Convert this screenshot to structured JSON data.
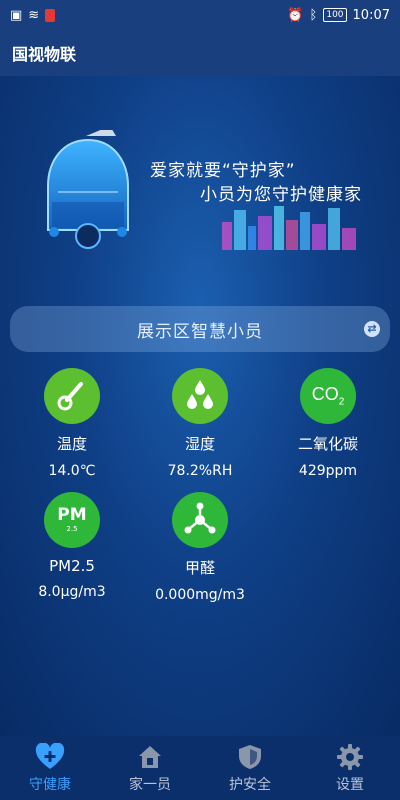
{
  "statusbar": {
    "battery": "100",
    "time": "10:07"
  },
  "app": {
    "title": "国视物联"
  },
  "hero": {
    "line1": "爱家就要“守护家”",
    "line2": "小员为您守护健康家"
  },
  "zone": {
    "title": "展示区智慧小员"
  },
  "sensors": [
    {
      "label": "温度",
      "value": "14.0℃",
      "icon": "thermometer-icon"
    },
    {
      "label": "湿度",
      "value": "78.2%RH",
      "icon": "water-drops-icon"
    },
    {
      "label": "二氧化碳",
      "value": "429ppm",
      "icon_text": "CO",
      "icon_sub": "2"
    },
    {
      "label": "PM2.5",
      "value": "8.0μg/m3",
      "icon_text": "PM",
      "icon_sub": "2.5"
    },
    {
      "label": "甲醛",
      "value": "0.000mg/m3",
      "icon": "molecule-icon"
    }
  ],
  "tabs": [
    {
      "label": "守健康",
      "active": true
    },
    {
      "label": "家一员"
    },
    {
      "label": "护安全"
    },
    {
      "label": "设置"
    }
  ],
  "colors": {
    "accent": "#3aa0ff",
    "sensor_green": "#5cbf2f",
    "bg": "#0a2a63"
  }
}
